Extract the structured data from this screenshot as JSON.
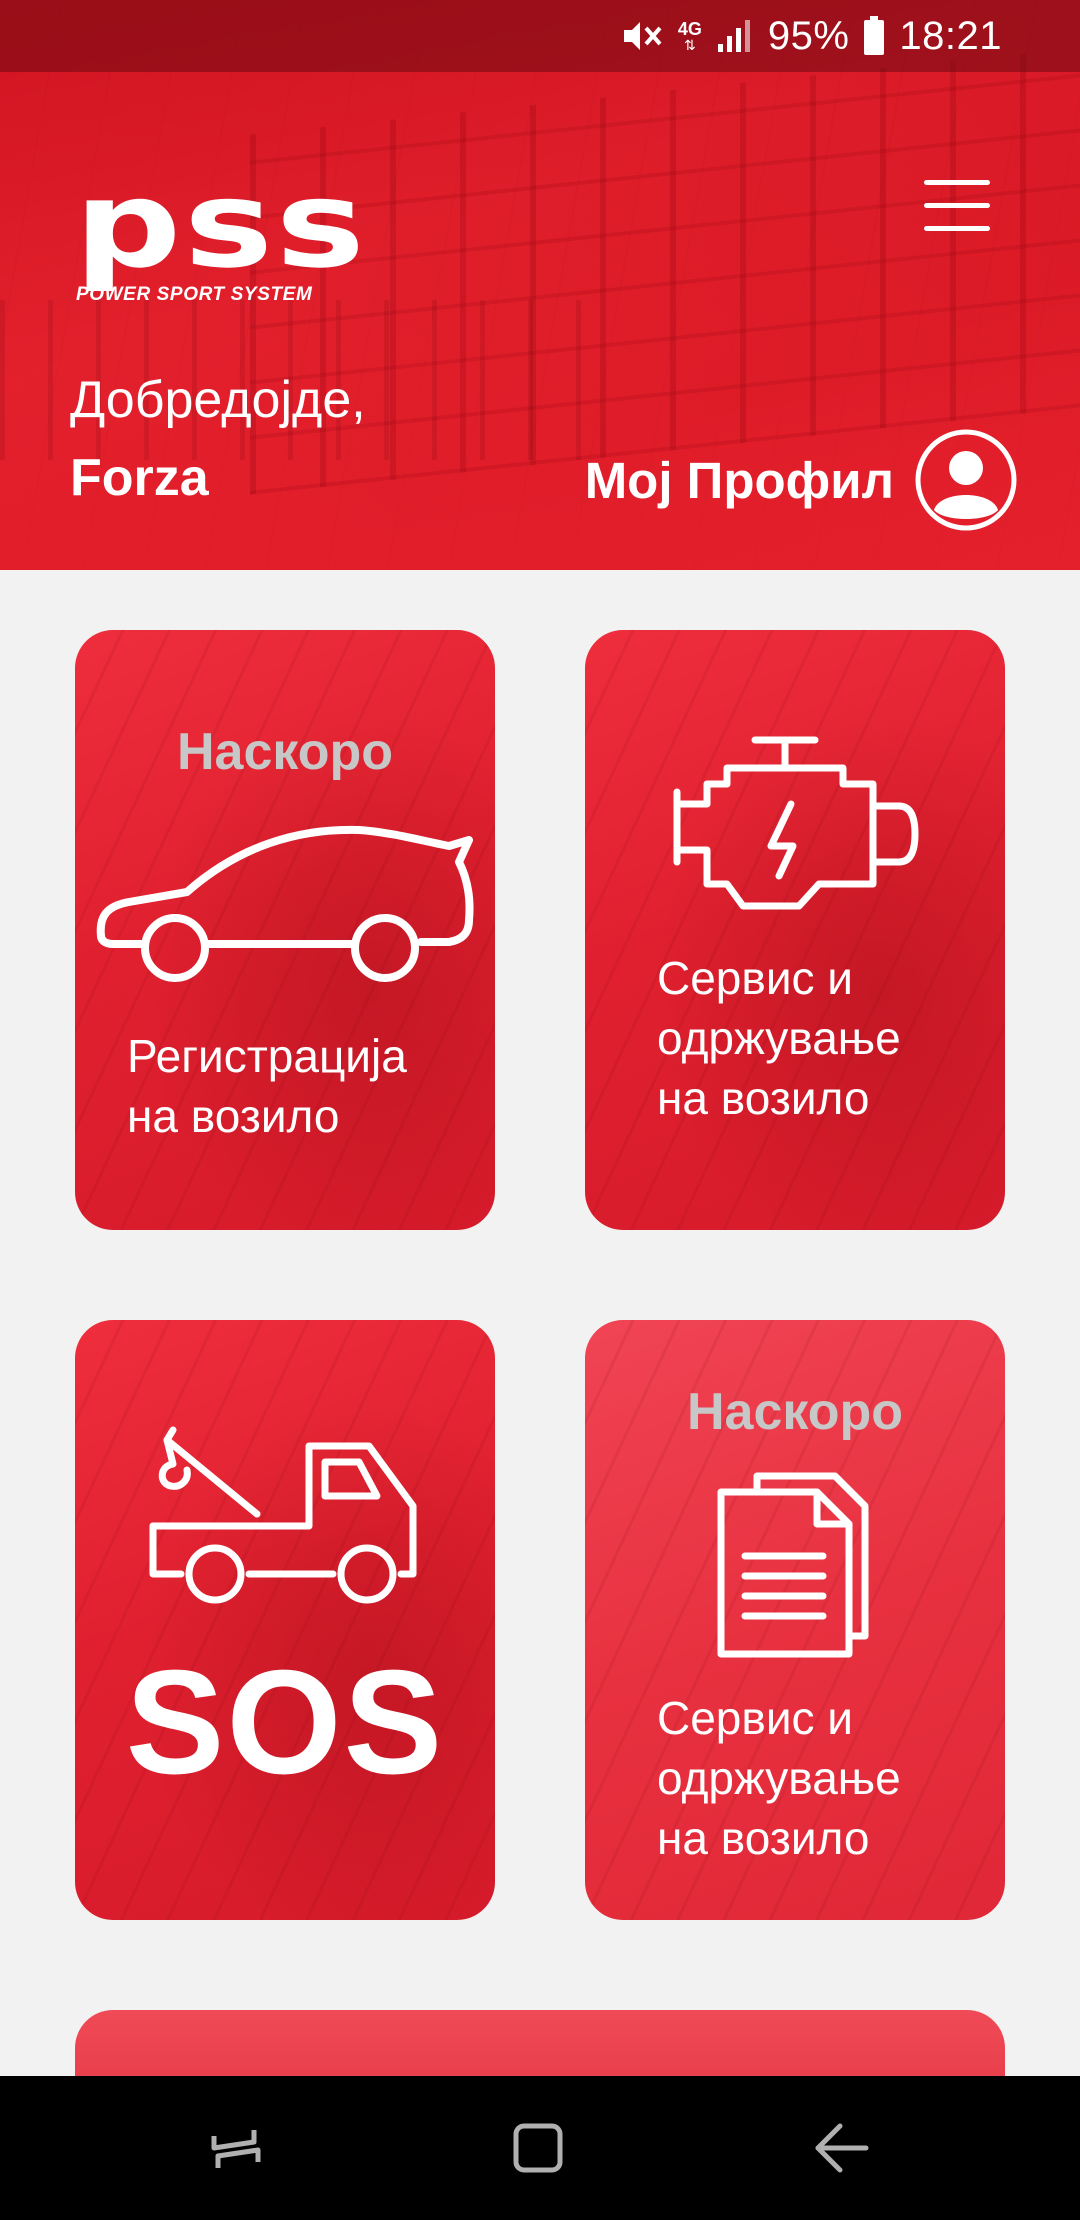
{
  "status_bar": {
    "network": "4G",
    "battery": "95%",
    "time": "18:21",
    "icons": [
      "mute-vibrate-icon",
      "4g-data-icon",
      "signal-icon",
      "battery-icon"
    ]
  },
  "header": {
    "logo_text": "pss",
    "logo_subtitle": "POWER SPORT SYSTEM",
    "greeting": "Добредојде,",
    "user_name": "Forza",
    "profile_label": "Мој Профил"
  },
  "tiles": [
    {
      "soon": "Наскоро",
      "label": "Регистрација\nна возило",
      "icon": "car-icon"
    },
    {
      "soon": "",
      "label": "Сервис и\nодржување\nна возило",
      "icon": "engine-icon"
    },
    {
      "soon": "",
      "label": "SOS",
      "icon": "tow-truck-icon"
    },
    {
      "soon": "Наскоро",
      "label": "Сервис и\nодржување\nна возило",
      "icon": "documents-icon"
    }
  ],
  "colors": {
    "brand_red": "#e0202f",
    "soon_gray": "#c7c7c7",
    "text_white": "#ffffff"
  }
}
